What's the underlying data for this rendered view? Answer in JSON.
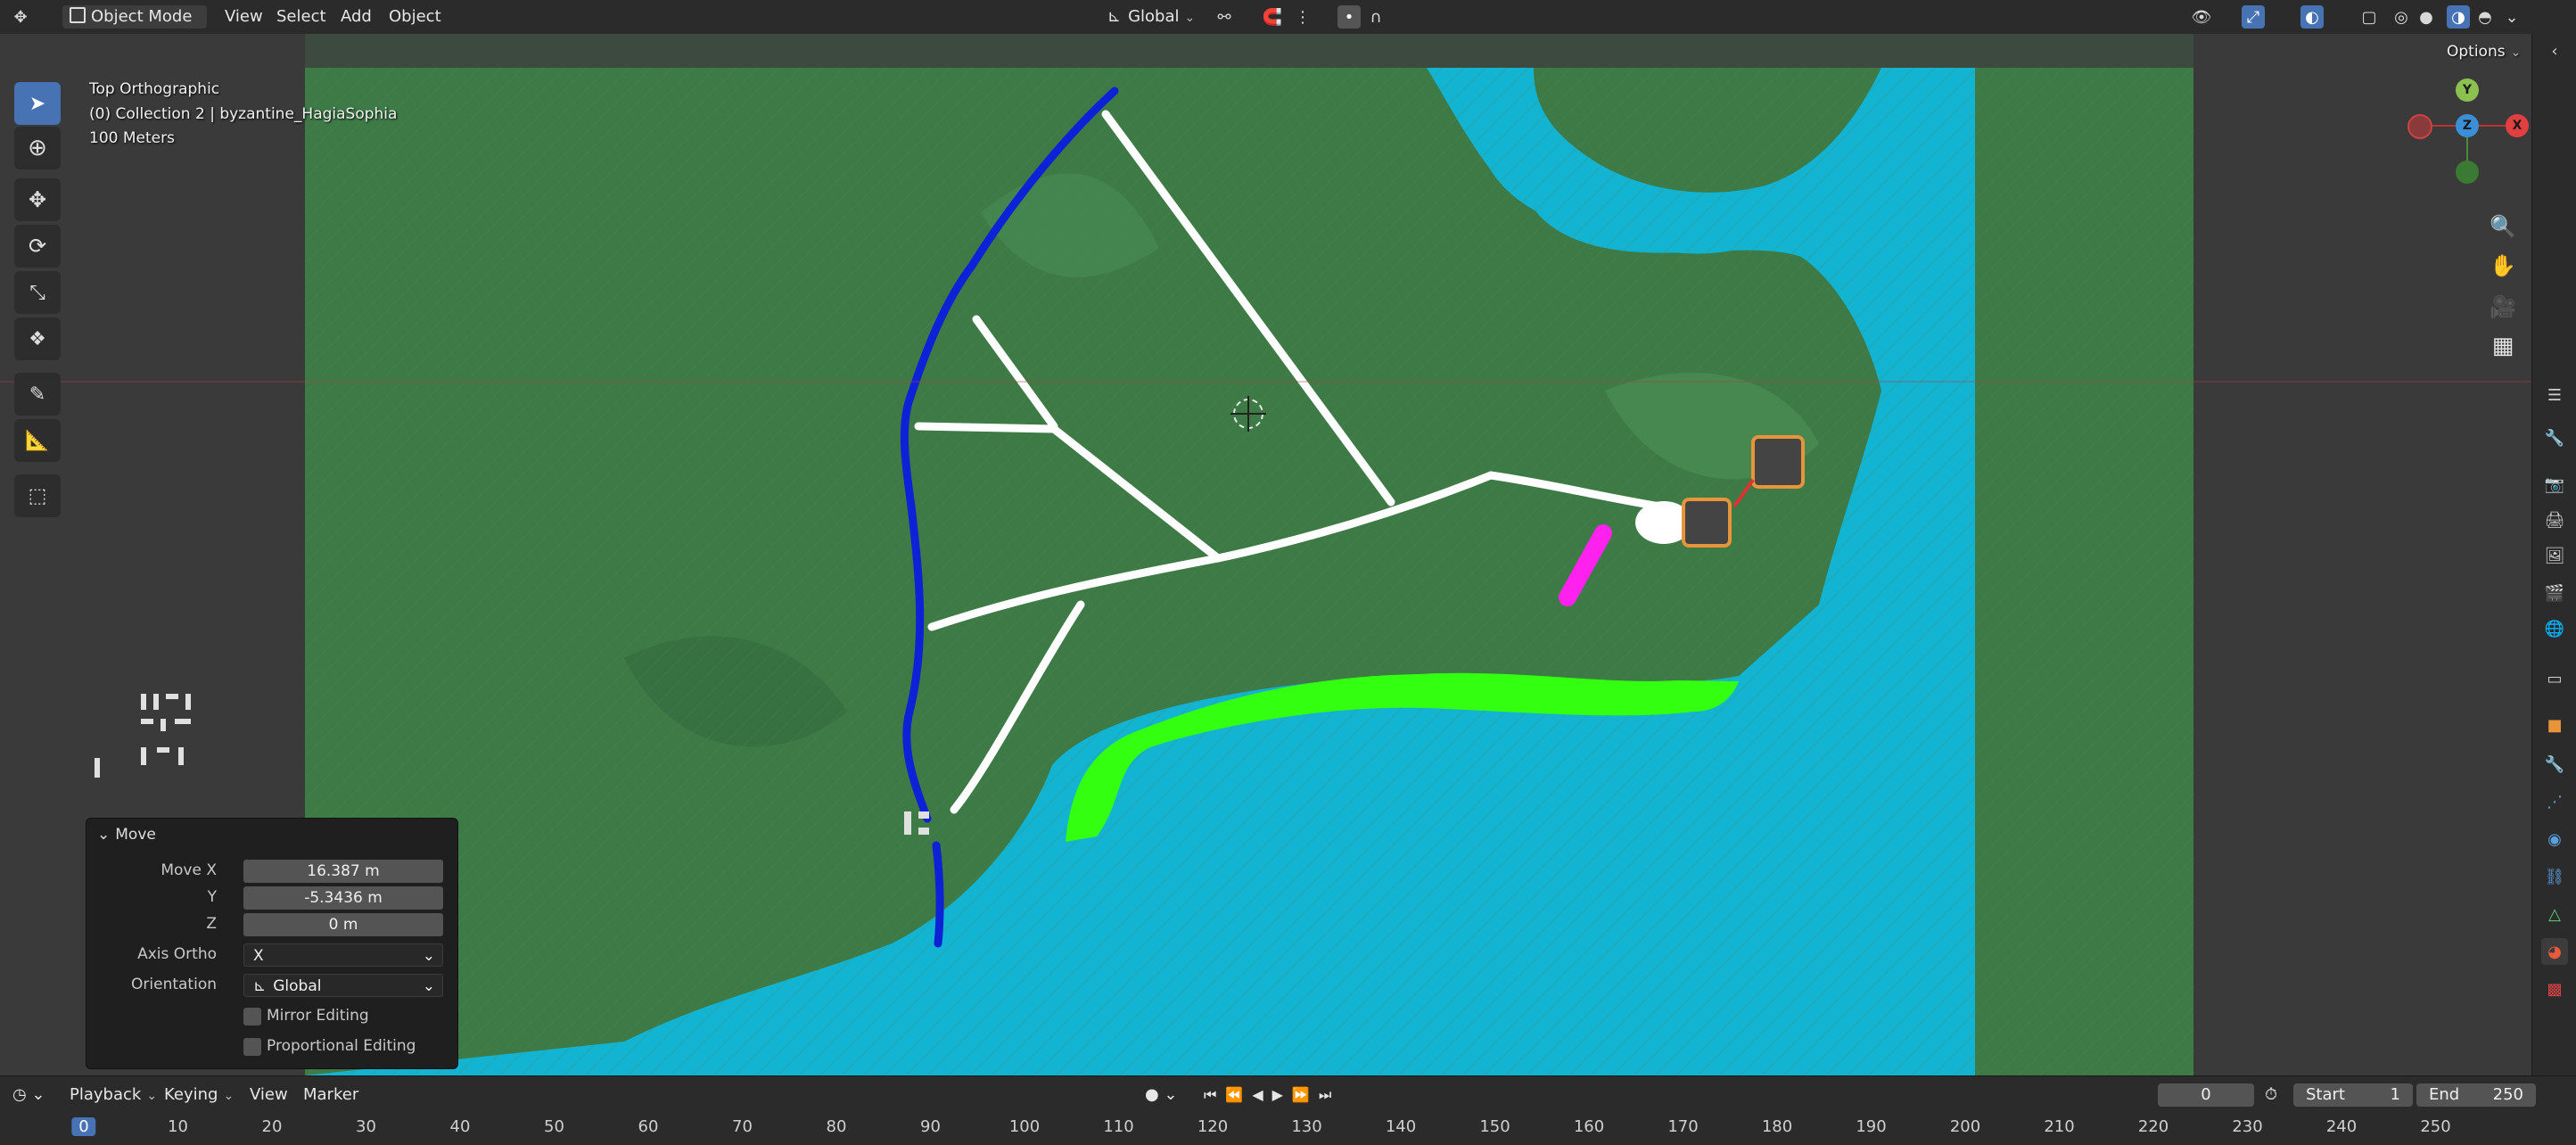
{
  "header": {
    "mode_label": "Object Mode",
    "menu": [
      "View",
      "Select",
      "Add",
      "Object"
    ],
    "orientation_label": "Global"
  },
  "viewport": {
    "view_name": "Top Orthographic",
    "collection_info": "(0) Collection 2 | byzantine_HagiaSophia",
    "scale_label": "100 Meters",
    "options_label": "Options",
    "gizmo": {
      "x": "X",
      "y": "Y",
      "z": "Z"
    }
  },
  "operator_panel": {
    "title": "Move",
    "fields": [
      {
        "label": "Move X",
        "value": "16.387 m"
      },
      {
        "label": "Y",
        "value": "-5.3436 m"
      },
      {
        "label": "Z",
        "value": "0 m"
      }
    ],
    "axis_ortho": {
      "label": "Axis Ortho",
      "value": "X"
    },
    "orientation": {
      "label": "Orientation",
      "value": "Global"
    },
    "mirror_label": "Mirror Editing",
    "proportional_label": "Proportional Editing"
  },
  "timeline": {
    "menu": [
      "Playback",
      "Keying",
      "View",
      "Marker"
    ],
    "current_frame": "0",
    "start_label": "Start",
    "start_value": "1",
    "end_label": "End",
    "end_value": "250",
    "frames": [
      "0",
      "10",
      "20",
      "30",
      "40",
      "50",
      "60",
      "70",
      "80",
      "90",
      "100",
      "110",
      "120",
      "130",
      "140",
      "150",
      "160",
      "170",
      "180",
      "190",
      "200",
      "210",
      "220",
      "230",
      "240",
      "250"
    ]
  },
  "colors": {
    "accent": "#4772b3",
    "water": "#13b3d2",
    "land": "#3f7f4a",
    "road": "#ffffff",
    "river": "#0d22d6",
    "shore_green": "#33ff11",
    "magenta": "#ff22ee"
  }
}
